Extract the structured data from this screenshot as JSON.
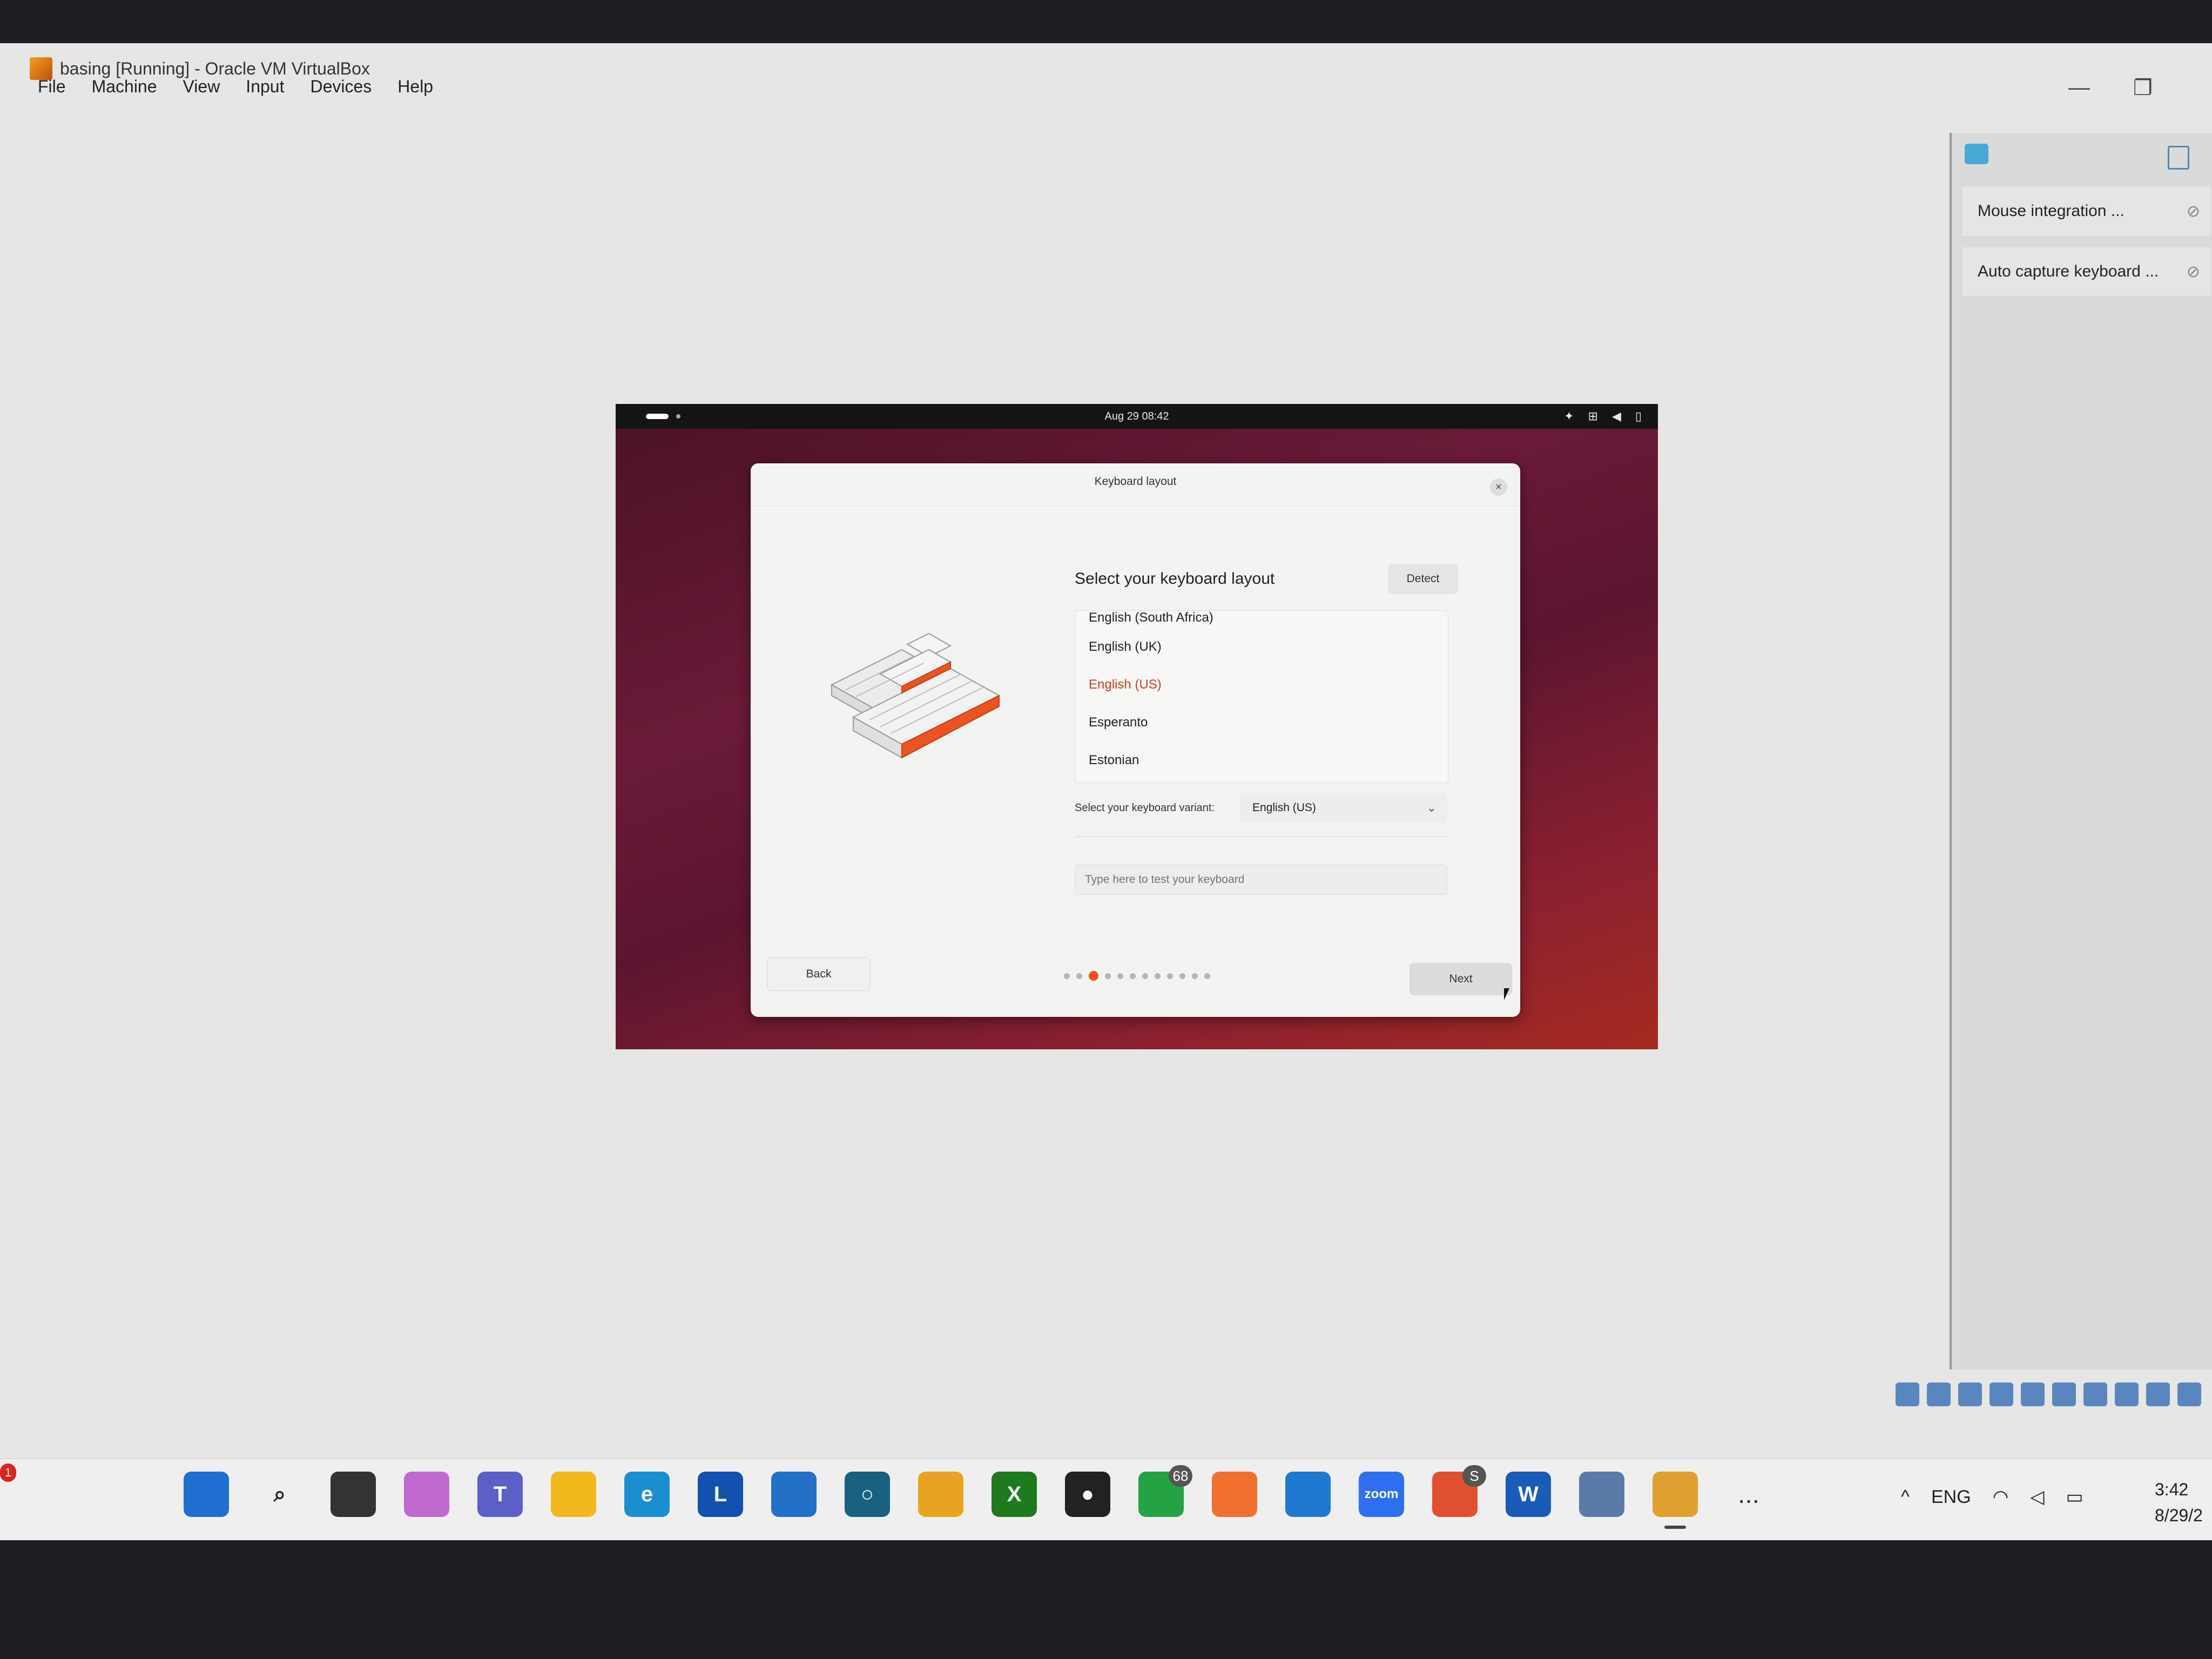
{
  "window": {
    "title": "basing [Running] - Oracle VM VirtualBox",
    "menu": [
      "File",
      "Machine",
      "View",
      "Input",
      "Devices",
      "Help"
    ]
  },
  "side_panel": {
    "items": [
      "Mouse integration ...",
      "Auto capture keyboard ..."
    ]
  },
  "vm": {
    "clock": "Aug 29  08:42",
    "dialog": {
      "title": "Keyboard layout",
      "heading": "Select your keyboard layout",
      "detect_label": "Detect",
      "layouts": [
        "English (South Africa)",
        "English (UK)",
        "English (US)",
        "Esperanto",
        "Estonian"
      ],
      "selected_layout": "English (US)",
      "variant_label": "Select your keyboard variant:",
      "variant_value": "English (US)",
      "test_placeholder": "Type here to test your keyboard",
      "back_label": "Back",
      "next_label": "Next",
      "progress": {
        "total": 12,
        "current": 3
      }
    }
  },
  "taskbar": {
    "notification_count": "1",
    "apps": [
      {
        "name": "windows-start",
        "glyph": "",
        "color": "#1f6fd0"
      },
      {
        "name": "search",
        "glyph": "⌕",
        "color": "#f0eff0"
      },
      {
        "name": "task-view",
        "glyph": "",
        "color": "#333333"
      },
      {
        "name": "copilot",
        "glyph": "",
        "color": "#c06ad0"
      },
      {
        "name": "teams",
        "glyph": "T",
        "color": "#5b5fc7"
      },
      {
        "name": "file-explorer",
        "glyph": "",
        "color": "#f2b91e"
      },
      {
        "name": "edge",
        "glyph": "e",
        "color": "#1a8fd0"
      },
      {
        "name": "l-app",
        "glyph": "L",
        "color": "#1450b0"
      },
      {
        "name": "ms-store",
        "glyph": "",
        "color": "#2370c8"
      },
      {
        "name": "cortana",
        "glyph": "○",
        "color": "#1a6080"
      },
      {
        "name": "chrome",
        "glyph": "",
        "color": "#e8a420"
      },
      {
        "name": "xbox",
        "glyph": "X",
        "color": "#1d7a1d"
      },
      {
        "name": "obs",
        "glyph": "●",
        "color": "#222222"
      },
      {
        "name": "whatsapp",
        "glyph": "",
        "color": "#25a244",
        "badge": "68"
      },
      {
        "name": "xampp",
        "glyph": "",
        "color": "#f07030"
      },
      {
        "name": "vscode",
        "glyph": "",
        "color": "#1e78d0"
      },
      {
        "name": "zoom",
        "glyph": "zoom",
        "color": "#2d6ff0"
      },
      {
        "name": "chrome-profile",
        "glyph": "",
        "color": "#e05030",
        "badge": "S"
      },
      {
        "name": "word",
        "glyph": "W",
        "color": "#1a5ab8"
      },
      {
        "name": "virtualbox",
        "glyph": "",
        "color": "#5a7aa8"
      },
      {
        "name": "virtualbox-vm",
        "glyph": "",
        "color": "#e0a030",
        "active": true
      }
    ],
    "more": "...",
    "tray": {
      "caret": "^",
      "language": "ENG"
    },
    "time": "3:42",
    "date": "8/29/2"
  }
}
